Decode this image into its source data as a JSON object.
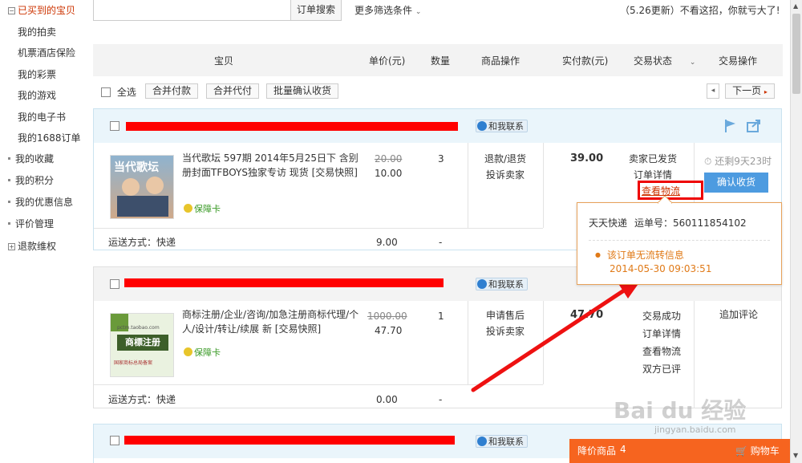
{
  "sidebar": {
    "items": [
      {
        "label": "已买到的宝贝",
        "kind": "box",
        "active": true
      },
      {
        "label": "我的拍卖",
        "kind": "sub"
      },
      {
        "label": "机票酒店保险",
        "kind": "sub"
      },
      {
        "label": "我的彩票",
        "kind": "sub"
      },
      {
        "label": "我的游戏",
        "kind": "sub"
      },
      {
        "label": "我的电子书",
        "kind": "sub"
      },
      {
        "label": "我的1688订单",
        "kind": "sub"
      },
      {
        "label": "我的收藏",
        "kind": "dot"
      },
      {
        "label": "我的积分",
        "kind": "dot"
      },
      {
        "label": "我的优惠信息",
        "kind": "dot"
      },
      {
        "label": "评价管理",
        "kind": "dot"
      },
      {
        "label": "退款维权",
        "kind": "box"
      }
    ]
  },
  "filter": {
    "search_button": "订单搜索",
    "more": "更多筛选条件",
    "notice": "（5.26更新）不看这招，你就亏大了!"
  },
  "header": {
    "item": "宝贝",
    "price": "单价(元)",
    "qty": "数量",
    "ops": "商品操作",
    "paid": "实付款(元)",
    "status": "交易状态",
    "actions": "交易操作"
  },
  "toolbar": {
    "select_all": "全选",
    "merge_pay": "合并付款",
    "merge_proxy": "合并代付",
    "batch_confirm": "批量确认收货",
    "next_page": "下一页"
  },
  "chat_label": "和我联系",
  "guarantee_label": "保障卡",
  "shipping_label": "运送方式：快递",
  "orders": [
    {
      "title": "当代歌坛 597期 2014年5月25日下 含别册封面TFBOYS独家专访 现货 [交易快照]",
      "orig_price": "20.00",
      "price": "10.00",
      "qty": "3",
      "op1": "退款/退货",
      "op2": "投诉卖家",
      "paid": "39.00",
      "status1": "卖家已发货",
      "status2": "订单详情",
      "status3": "查看物流",
      "timer": "还剩9天23时",
      "confirm": "确认收货",
      "ship_fee": "9.00",
      "ship_dash": "-",
      "thumb_text": "当代歌坛"
    },
    {
      "title": "商标注册/企业/咨询/加急注册商标代理/个人/设计/转让/续展 新 [交易快照]",
      "orig_price": "1000.00",
      "price": "47.70",
      "qty": "1",
      "op1": "申请售后",
      "op2": "投诉卖家",
      "paid": "47.70",
      "status1": "交易成功",
      "status2": "订单详情",
      "status3": "查看物流",
      "status4": "双方已评",
      "action": "追加评论",
      "ship_fee": "0.00",
      "ship_dash": "-",
      "thumb_text": "商標注册",
      "thumb_sub": "国家商标总局备案",
      "thumb_site": "pctm.taobao.com"
    }
  ],
  "popup": {
    "carrier": "天天快递",
    "tracking": "运单号：560111854102",
    "message": "该订单无流转信息",
    "time": "2014-05-30 09:03:51"
  },
  "cart": {
    "label": "降价商品",
    "count": "4",
    "cart_label": "购物车"
  },
  "watermark": {
    "text": "Bai du 经验",
    "url": "jingyan.baidu.com"
  },
  "colors": {
    "accent_orange": "#f6641f",
    "link_red": "#c30",
    "confirm_blue": "#4d9be0",
    "redaction": "#ff0000"
  }
}
